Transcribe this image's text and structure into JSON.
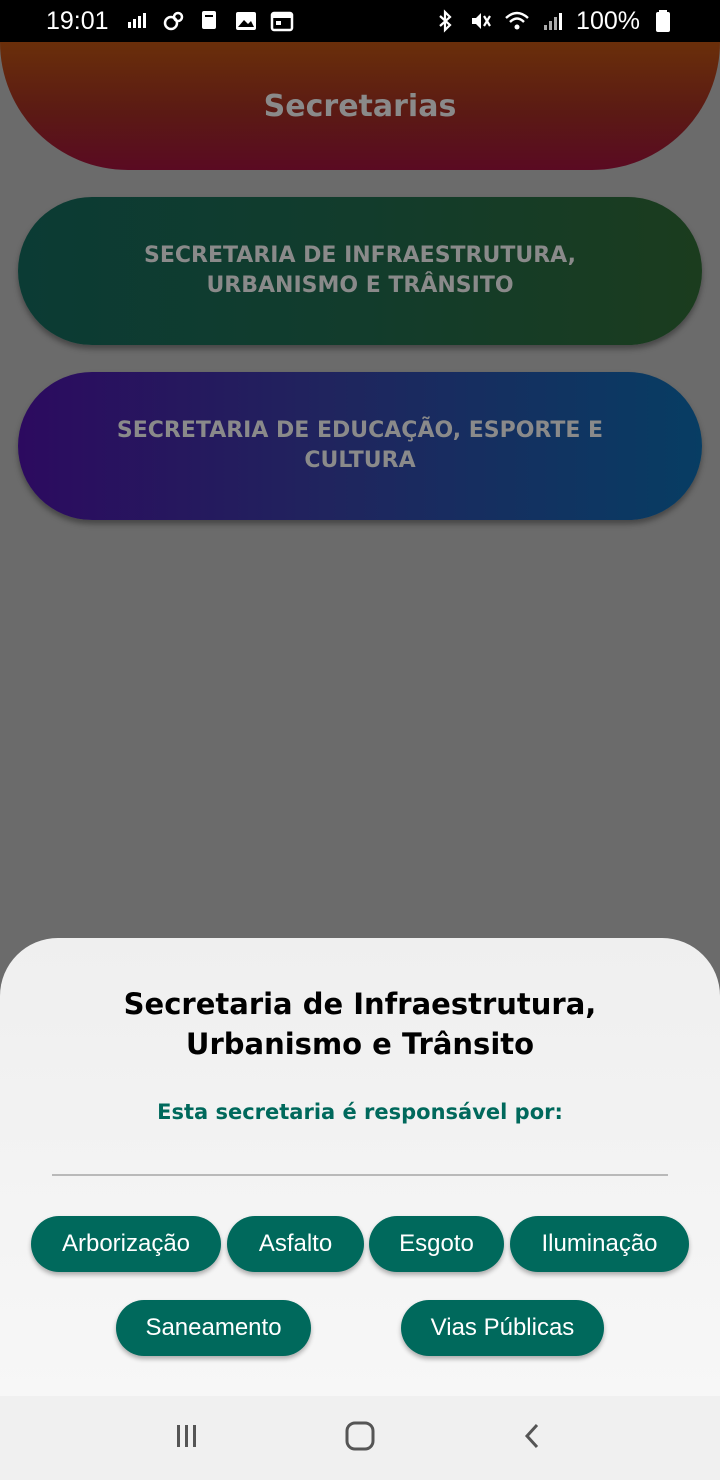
{
  "status_bar": {
    "time": "19:01",
    "battery": "100%",
    "icons_left": [
      "signal-bars-icon",
      "weather-icon",
      "app-notification-icon",
      "image-icon",
      "calendar-icon"
    ],
    "icons_right": [
      "bluetooth-icon",
      "mute-icon",
      "wifi-icon",
      "cell-signal-icon",
      "battery-icon"
    ]
  },
  "header": {
    "title": "Secretarias"
  },
  "cards": [
    {
      "label": "SECRETARIA DE INFRAESTRUTURA, URBANISMO E TRÂNSITO"
    },
    {
      "label": "SECRETARIA DE EDUCAÇÃO, ESPORTE E CULTURA"
    }
  ],
  "sheet": {
    "title": "Secretaria de Infraestrutura, Urbanismo e Trânsito",
    "subtitle": "Esta secretaria é responsável por:",
    "chips": [
      "Arborização",
      "Asfalto",
      "Esgoto",
      "Iluminação",
      "Saneamento",
      "Vias Públicas"
    ]
  },
  "nav_bar": {
    "buttons": [
      "recents-icon",
      "home-icon",
      "back-icon"
    ]
  },
  "colors": {
    "chip_bg": "#00695c",
    "subtitle": "#00695c",
    "scrim": "#6b6b6b"
  }
}
